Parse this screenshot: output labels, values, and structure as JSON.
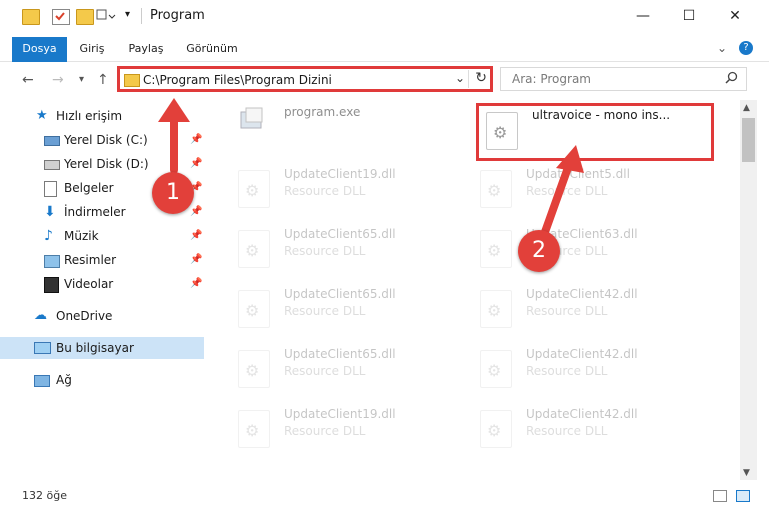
{
  "window": {
    "title": "Program"
  },
  "ribbon": {
    "tabs": [
      "Dosya",
      "Giriş",
      "Paylaş",
      "Görünüm"
    ]
  },
  "nav": {
    "back": "←",
    "forward": "→",
    "recent": "▾",
    "up": "↑"
  },
  "address": {
    "path": "C:\\Program Files\\Program Dizini",
    "chevron": "⌄",
    "refresh": "↻"
  },
  "search": {
    "placeholder": "Ara: Program",
    "icon": "search-icon"
  },
  "sidebar": {
    "items": [
      {
        "label": "Hızlı erişim",
        "icon": "star-icon",
        "pinned": false
      },
      {
        "label": "Yerel Disk (C:)",
        "icon": "drive-icon",
        "pinned": true
      },
      {
        "label": "Yerel Disk (D:)",
        "icon": "drive-icon",
        "pinned": true
      },
      {
        "label": "Belgeler",
        "icon": "documents-icon",
        "pinned": true
      },
      {
        "label": "İndirmeler",
        "icon": "download-icon",
        "pinned": true
      },
      {
        "label": "Müzik",
        "icon": "music-icon",
        "pinned": true
      },
      {
        "label": "Resimler",
        "icon": "pictures-icon",
        "pinned": true
      },
      {
        "label": "Videolar",
        "icon": "video-icon",
        "pinned": true
      },
      {
        "label": "OneDrive",
        "icon": "cloud-icon",
        "pinned": false
      },
      {
        "label": "Bu bilgisayar",
        "icon": "computer-icon",
        "pinned": false
      },
      {
        "label": "Ağ",
        "icon": "network-icon",
        "pinned": false
      }
    ],
    "pin_glyph": "📌"
  },
  "files": {
    "exe": {
      "name": "program.exe"
    },
    "highlighted": {
      "name": "ultravoice - mono ins..."
    },
    "left_col": [
      {
        "name": "UpdateClient19.dll",
        "type": "Resource DLL"
      },
      {
        "name": "UpdateClient65.dll",
        "type": "Resource DLL"
      },
      {
        "name": "UpdateClient65.dll",
        "type": "Resource DLL"
      },
      {
        "name": "UpdateClient65.dll",
        "type": "Resource DLL"
      },
      {
        "name": "UpdateClient19.dll",
        "type": "Resource DLL"
      }
    ],
    "right_col": [
      {
        "name": "UpdateClient5.dll",
        "type": "Resource DLL"
      },
      {
        "name": "UpdateClient63.dll",
        "type": "Resource DLL"
      },
      {
        "name": "UpdateClient42.dll",
        "type": "Resource DLL"
      },
      {
        "name": "UpdateClient42.dll",
        "type": "Resource DLL"
      },
      {
        "name": "UpdateClient42.dll",
        "type": "Resource DLL"
      }
    ]
  },
  "status": {
    "count": "132 öğe"
  },
  "annotations": {
    "badge1": "1",
    "badge2": "2",
    "color": "#e2403a"
  }
}
